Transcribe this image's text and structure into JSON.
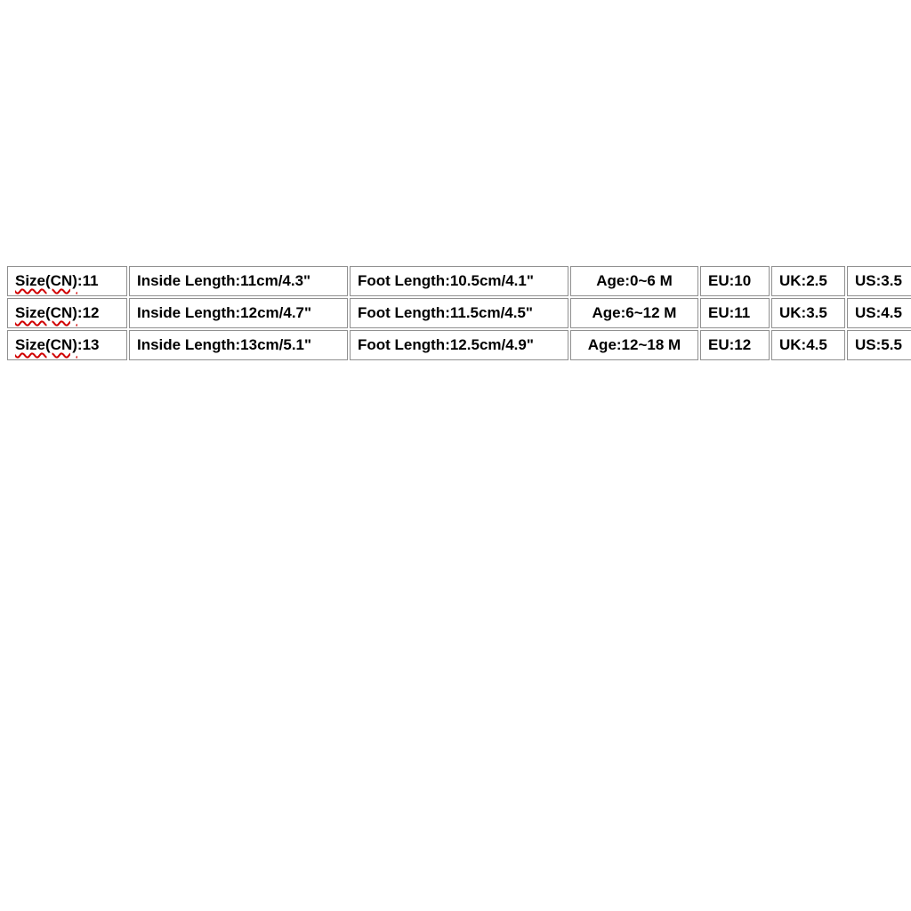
{
  "chart_data": {
    "type": "table",
    "columns": [
      "Size(CN)",
      "Inside Length",
      "Foot Length",
      "Age",
      "EU",
      "UK",
      "US"
    ],
    "rows": [
      {
        "size_cn": "11",
        "inside_length": "11cm/4.3\"",
        "foot_length": "10.5cm/4.1\"",
        "age": "0~6 M",
        "eu": "10",
        "uk": "2.5",
        "us": "3.5"
      },
      {
        "size_cn": "12",
        "inside_length": "12cm/4.7\"",
        "foot_length": "11.5cm/4.5\"",
        "age": "6~12 M",
        "eu": "11",
        "uk": "3.5",
        "us": "4.5"
      },
      {
        "size_cn": "13",
        "inside_length": "13cm/5.1\"",
        "foot_length": "12.5cm/4.9\"",
        "age": "12~18 M",
        "eu": "12",
        "uk": "4.5",
        "us": "5.5"
      }
    ]
  },
  "labels": {
    "size_cn": "Size(CN)",
    "inside_length": "Inside Length",
    "foot_length": "Foot Length",
    "age": "Age",
    "eu": "EU",
    "uk": "UK",
    "us": "US"
  },
  "cells": {
    "r0": {
      "size": "Size(CN):11",
      "inside": "Inside Length:11cm/4.3\"",
      "foot": "Foot Length:10.5cm/4.1\"",
      "age": "Age:0~6 M",
      "eu": "EU:10",
      "uk": "UK:2.5",
      "us": "US:3.5"
    },
    "r1": {
      "size": "Size(CN):12",
      "inside": "Inside Length:12cm/4.7\"",
      "foot": "Foot Length:11.5cm/4.5\"",
      "age": "Age:6~12 M",
      "eu": "EU:11",
      "uk": "UK:3.5",
      "us": "US:4.5"
    },
    "r2": {
      "size": "Size(CN):13",
      "inside": "Inside Length:13cm/5.1\"",
      "foot": "Foot Length:12.5cm/4.9\"",
      "age": "Age:12~18 M",
      "eu": "EU:12",
      "uk": "UK:4.5",
      "us": "US:5.5"
    }
  }
}
